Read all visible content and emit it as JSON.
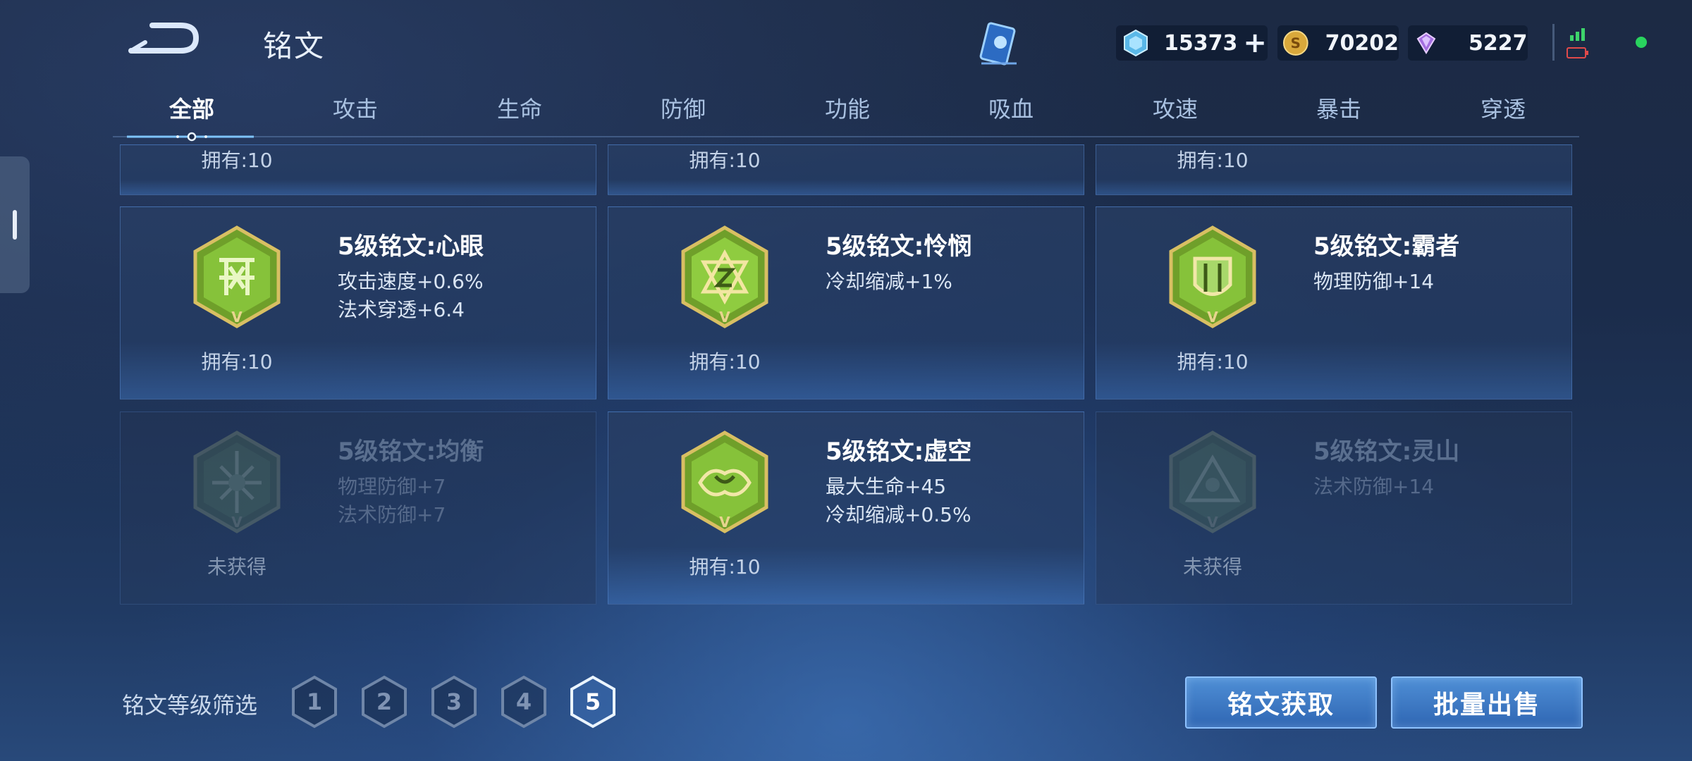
{
  "header": {
    "title": "铭文",
    "currencies": [
      {
        "icon": "diamond-gem-icon",
        "value": "15373"
      },
      {
        "icon": "gold-coin-icon",
        "value": "70202"
      },
      {
        "icon": "purple-crystal-icon",
        "value": "5227"
      }
    ]
  },
  "tabs": [
    "全部",
    "攻击",
    "生命",
    "防御",
    "功能",
    "吸血",
    "攻速",
    "暴击",
    "穿透"
  ],
  "active_tab": "全部",
  "top_row_owned": [
    "拥有:10",
    "拥有:10",
    "拥有:10"
  ],
  "cards": [
    {
      "name": "5级铭文:心眼",
      "attrs": [
        "攻击速度+0.6%",
        "法术穿透+6.4"
      ],
      "owned": "拥有:10",
      "icon": "xinyan-rune-icon"
    },
    {
      "name": "5级铭文:怜悯",
      "attrs": [
        "冷却缩减+1%"
      ],
      "owned": "拥有:10",
      "icon": "lianmin-rune-icon"
    },
    {
      "name": "5级铭文:霸者",
      "attrs": [
        "物理防御+14"
      ],
      "owned": "拥有:10",
      "icon": "bazhe-rune-icon"
    },
    {
      "name": "5级铭文:均衡",
      "attrs": [
        "物理防御+7",
        "法术防御+7"
      ],
      "owned": "未获得",
      "icon": "junheng-rune-icon"
    },
    {
      "name": "5级铭文:虚空",
      "attrs": [
        "最大生命+45",
        "冷却缩减+0.5%"
      ],
      "owned": "拥有:10",
      "icon": "xukong-rune-icon"
    },
    {
      "name": "5级铭文:灵山",
      "attrs": [
        "法术防御+14"
      ],
      "owned": "未获得",
      "icon": "lingshan-rune-icon"
    }
  ],
  "footer": {
    "filter_label": "铭文等级筛选",
    "levels": [
      "1",
      "2",
      "3",
      "4",
      "5"
    ],
    "selected_level": "5",
    "obtain_button": "铭文获取",
    "sell_button": "批量出售"
  },
  "colors": {
    "accent": "#4f8fd6",
    "rune_green": "#7fbf2f",
    "rune_gold": "#c9a94a"
  }
}
